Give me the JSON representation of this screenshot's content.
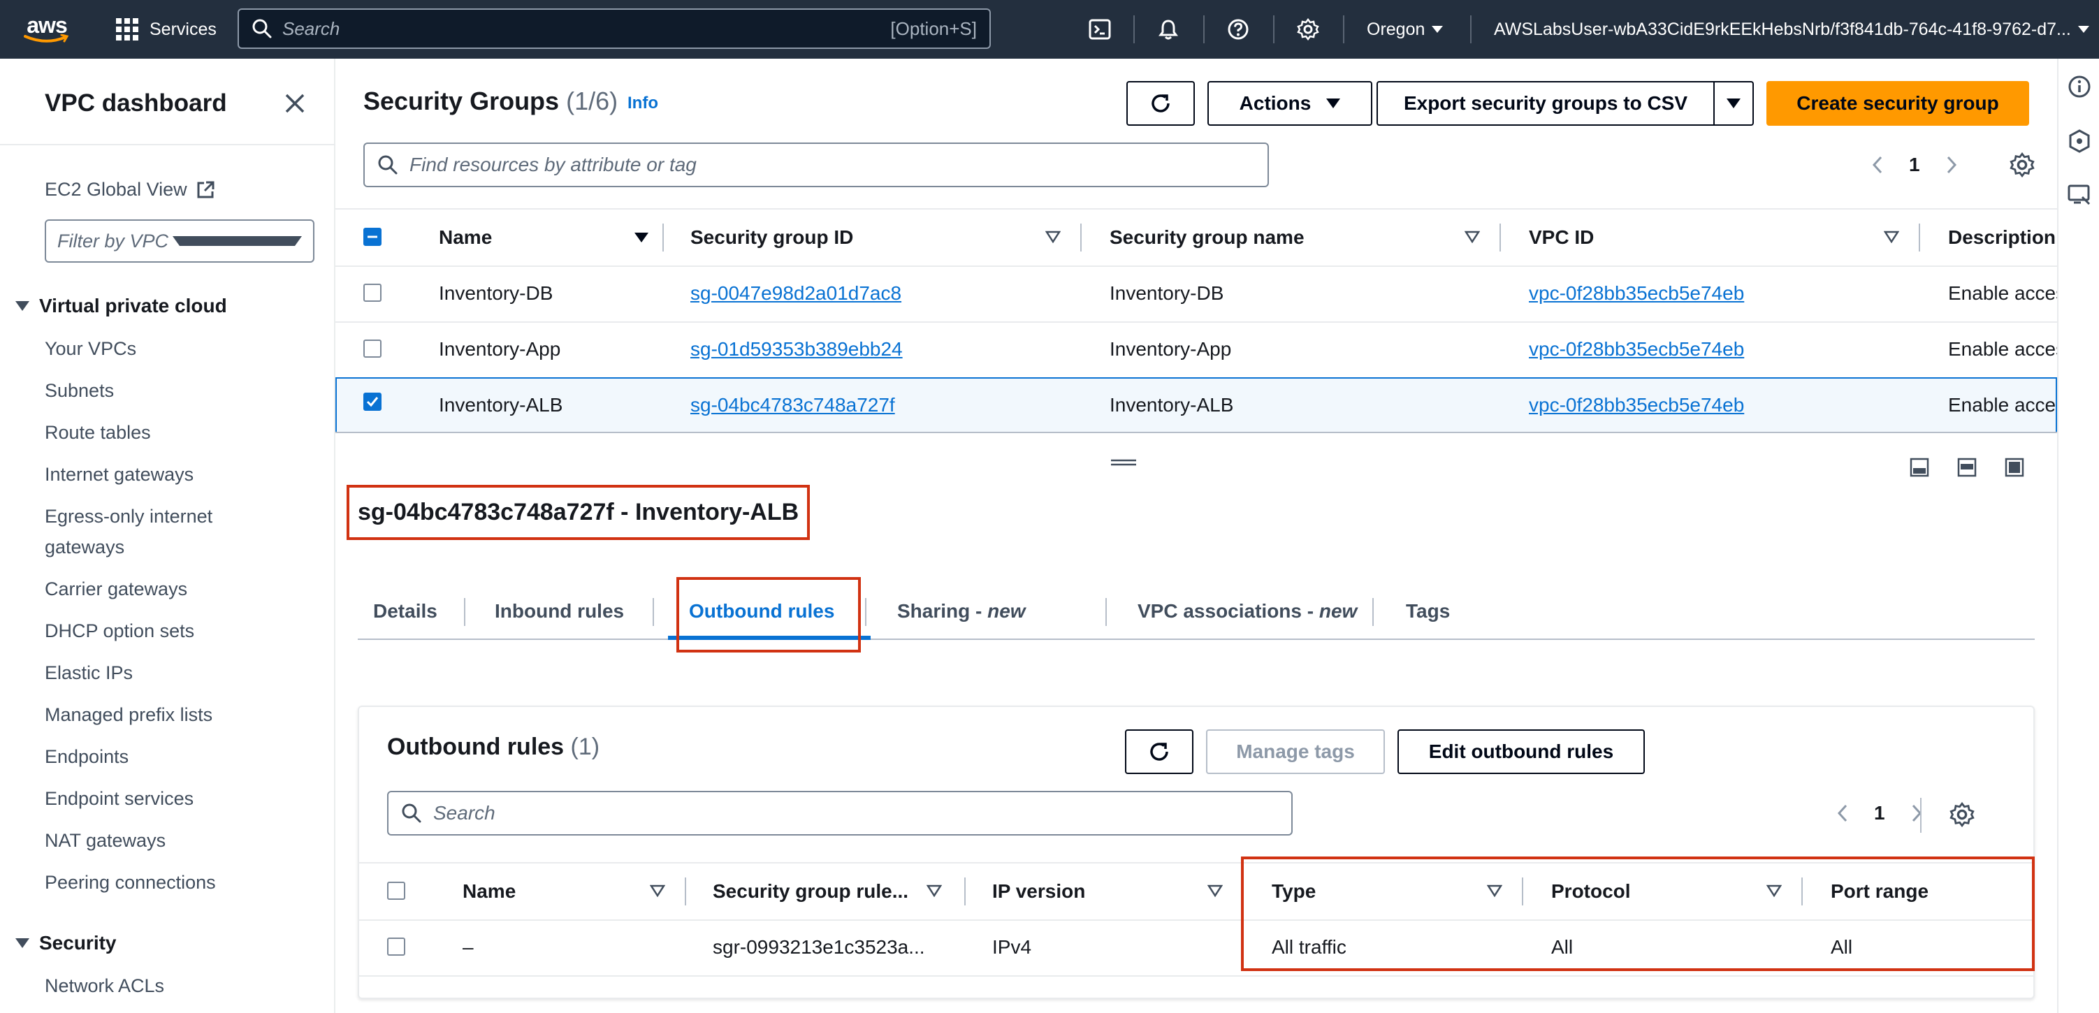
{
  "topnav": {
    "logo_text": "aws",
    "services_label": "Services",
    "search_placeholder": "Search",
    "search_shortcut": "[Option+S]",
    "region": "Oregon",
    "account": "AWSLabsUser-wbA33CidE9rkEEkHebsNrb/f3f841db-764c-41f8-9762-d7..."
  },
  "sidebar": {
    "title": "VPC dashboard",
    "ec2_global_view": "EC2 Global View",
    "filter_placeholder": "Filter by VPC",
    "section_vpc": "Virtual private cloud",
    "vpc_items": [
      "Your VPCs",
      "Subnets",
      "Route tables",
      "Internet gateways",
      "Egress-only internet",
      "gateways",
      "Carrier gateways",
      "DHCP option sets",
      "Elastic IPs",
      "Managed prefix lists",
      "Endpoints",
      "Endpoint services",
      "NAT gateways",
      "Peering connections"
    ],
    "section_security": "Security",
    "security_items": [
      "Network ACLs"
    ]
  },
  "header": {
    "title": "Security Groups",
    "count": "(1/6)",
    "info": "Info",
    "actions_label": "Actions",
    "export_label": "Export security groups to CSV",
    "create_label": "Create security group",
    "search_placeholder": "Find resources by attribute or tag",
    "page_number": "1"
  },
  "sg_table": {
    "columns": [
      "Name",
      "Security group ID",
      "Security group name",
      "VPC ID",
      "Description"
    ],
    "rows": [
      {
        "name": "Inventory-DB",
        "id": "sg-0047e98d2a01d7ac8",
        "group_name": "Inventory-DB",
        "vpc": "vpc-0f28bb35ecb5e74eb",
        "desc": "Enable acces",
        "checked": false
      },
      {
        "name": "Inventory-App",
        "id": "sg-01d59353b389ebb24",
        "group_name": "Inventory-App",
        "vpc": "vpc-0f28bb35ecb5e74eb",
        "desc": "Enable acces",
        "checked": false
      },
      {
        "name": "Inventory-ALB",
        "id": "sg-04bc4783c748a727f",
        "group_name": "Inventory-ALB",
        "vpc": "vpc-0f28bb35ecb5e74eb",
        "desc": "Enable acces",
        "checked": true
      }
    ]
  },
  "details": {
    "selected_title": "sg-04bc4783c748a727f - Inventory-ALB",
    "tabs": {
      "details": "Details",
      "inbound": "Inbound rules",
      "outbound": "Outbound rules",
      "sharing": "Sharing - ",
      "sharing_new": "new",
      "vpc_assoc": "VPC associations - ",
      "vpc_assoc_new": "new",
      "tags": "Tags"
    },
    "active_tab": "Outbound rules"
  },
  "outbound": {
    "title": "Outbound rules",
    "count": "(1)",
    "manage_tags": "Manage tags",
    "edit_label": "Edit outbound rules",
    "search_placeholder": "Search",
    "page_number": "1",
    "columns": [
      "Name",
      "Security group rule...",
      "IP version",
      "Type",
      "Protocol",
      "Port range"
    ],
    "rows": [
      {
        "name": "–",
        "rule_id": "sgr-0993213e1c3523a...",
        "ip_version": "IPv4",
        "type": "All traffic",
        "protocol": "All",
        "port_range": "All"
      }
    ]
  },
  "colors": {
    "nav_bg": "#232f3e",
    "link": "#0972d3",
    "primary": "#ff9900",
    "highlight": "#d13212"
  }
}
